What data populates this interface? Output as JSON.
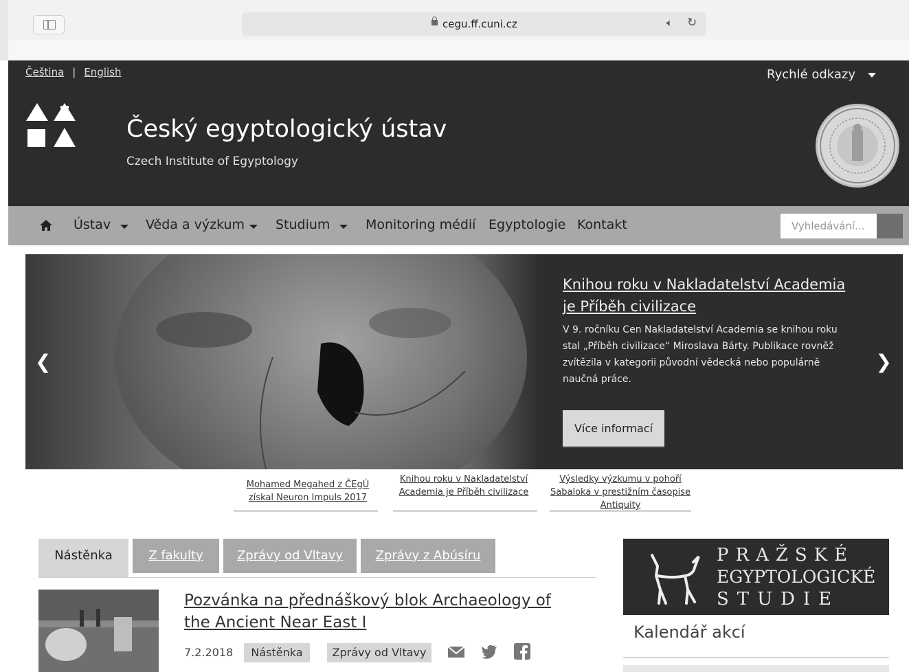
{
  "browser": {
    "url": "cegu.ff.cuni.cz"
  },
  "header": {
    "languages": [
      "Čeština",
      "English"
    ],
    "quick_links": "Rychlé odkazy",
    "title": "Český egyptologický ústav",
    "subtitle": "Czech Institute of Egyptology"
  },
  "nav": {
    "items": [
      "Ústav",
      "Věda a výzkum",
      "Studium",
      "Monitoring médií",
      "Egyptologie",
      "Kontakt"
    ],
    "search_placeholder": "Vyhledávání..."
  },
  "carousel": {
    "title": "Knihou roku v Nakladatelství Academia je Příběh civilizace",
    "text": "V 9. ročníku Cen Nakladatelství Academia se knihou roku stal „Příběh civilizace“ Miroslava Bárty. Publikace rovněž zvítězila v kategorii původní vědecká nebo populárně naučná práce.",
    "button": "Více informací",
    "thumbnails": [
      "Mohamed Megahed z ČEgÚ získal Neuron Impuls 2017",
      "Knihou roku v Nakladatelství Academia je Příběh civilizace",
      "Výsledky výzkumu v pohoří Sabaloka v prestižním časopise Antiquity"
    ]
  },
  "tabs": [
    "Nástěnka",
    "Z fakulty",
    "Zprávy od Vltavy",
    "Zprávy z Abúsíru"
  ],
  "article": {
    "title": "Pozvánka na přednáškový blok Archaeology of the Ancient Near East I",
    "date": "7.2.2018",
    "tags": [
      "Nástěnka",
      "Zprávy od Vltavy"
    ]
  },
  "sidebar": {
    "banner_lines": [
      "PRAŽSKÉ",
      "EGYPTOLOGICKÉ",
      "STUDIE"
    ],
    "calendar_title": "Kalendář akcí"
  },
  "colors": {
    "header_bg": "#2c2c2c",
    "nav_bg": "#a8a8a8",
    "tab_active": "#d6d6d6",
    "tab_inactive": "#a9a9a9"
  }
}
